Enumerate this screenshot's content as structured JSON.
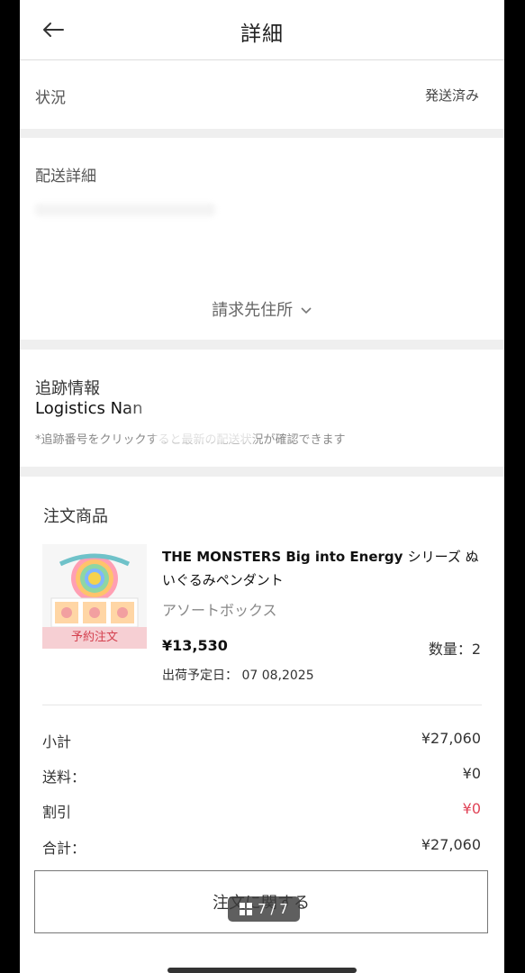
{
  "header": {
    "title": "詳細"
  },
  "status": {
    "label": "状況",
    "value": "発送済み"
  },
  "delivery": {
    "label": "配送詳細",
    "billing_link": "請求先住所"
  },
  "tracking": {
    "label": "追跡情報",
    "logistics": "Logistics Nan",
    "note": "*追跡番号をクリックすると最新の配送状況が確認できます"
  },
  "order": {
    "label": "注文商品",
    "product": {
      "name_en": "THE MONSTERS Big into Energy",
      "name_jp": "シリーズ ぬいぐるみペンダント",
      "variant": "アソートボックス",
      "price": "¥13,530",
      "qty": "数量：2",
      "ship_date": "出荷予定日： 07 08,2025",
      "preorder_tag": "予約注文"
    },
    "summary": {
      "subtotal_label": "小計",
      "subtotal": "¥27,060",
      "shipping_label": "送料：",
      "shipping": "¥0",
      "discount_label": "割引",
      "discount": "¥0",
      "total_label": "合計：",
      "total": "¥27,060"
    },
    "contact_button": "注文に関する"
  },
  "viewer": {
    "page_indicator": "7 / 7"
  },
  "colors": {
    "discount": "#e04357",
    "preorder_bg": "#f6cfd3",
    "preorder_text": "#d4404e"
  }
}
